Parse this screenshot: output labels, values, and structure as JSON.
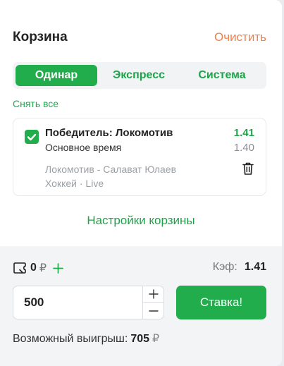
{
  "header": {
    "title": "Корзина",
    "clear_label": "Очистить"
  },
  "tabs": [
    {
      "label": "Одинар",
      "active": true
    },
    {
      "label": "Экспресс",
      "active": false
    },
    {
      "label": "Система",
      "active": false
    }
  ],
  "remove_all_label": "Снять все",
  "bet": {
    "checked": true,
    "title": "Победитель: Локомотив",
    "subtitle": "Основное время",
    "odds": "1.41",
    "old_odds": "1.40",
    "match": "Локомотив - Салават Юлаев",
    "sport_status": "Хоккей · Live"
  },
  "settings_label": "Настройки корзины",
  "footer": {
    "balance_value": "0",
    "currency": "₽",
    "coef_label": "Кэф:",
    "coef_value": "1.41",
    "stake_value": "500",
    "bet_button_label": "Ставка!",
    "win_label": "Возможный выигрыш:",
    "win_value": "705",
    "win_currency": "₽"
  },
  "colors": {
    "accent_green": "#22ad4c",
    "clear_orange": "#f08048"
  },
  "icons": [
    "check-icon",
    "trash-icon",
    "coupon-icon",
    "plus-icon",
    "minus-icon"
  ]
}
